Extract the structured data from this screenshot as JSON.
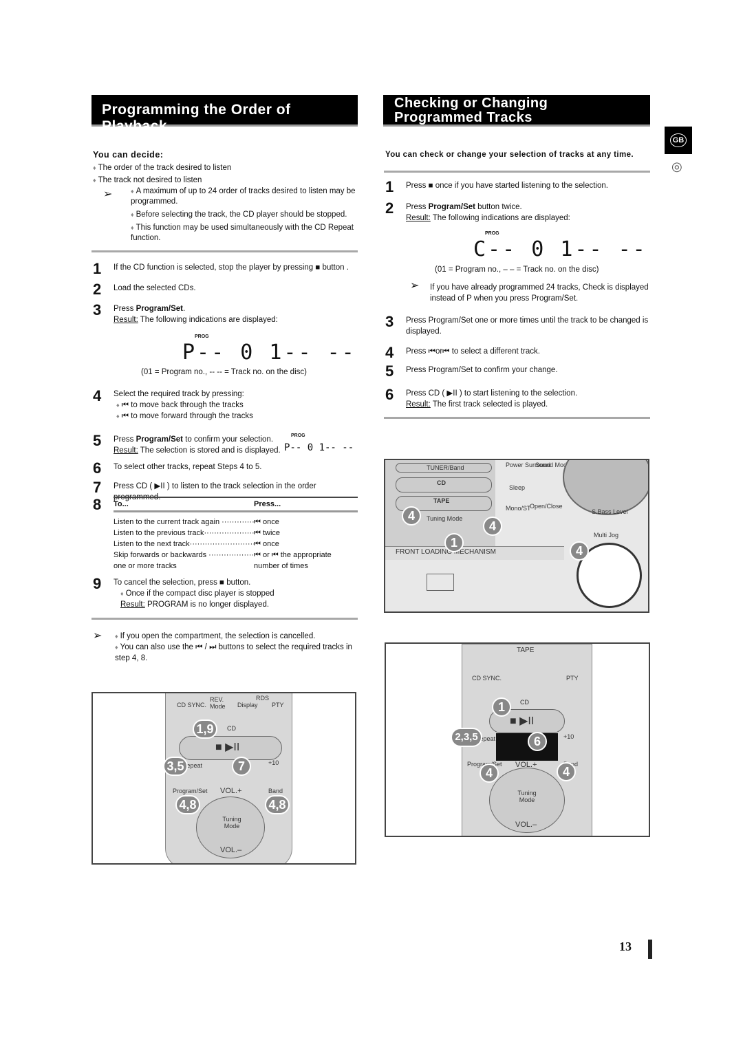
{
  "left": {
    "title": "Programming the Order of Playback",
    "decide_heading": "You can decide:",
    "decide_items": [
      "The order of the track desired to listen",
      "The track not desired to listen"
    ],
    "notes": [
      "A maximum of up to 24 order of tracks desired to listen may be programmed.",
      "Before selecting the track, the CD player should be stopped.",
      "This function may be used simultaneously with the CD Repeat function."
    ],
    "steps": {
      "s1": "If the CD function is selected, stop the player by pressing ■ button .",
      "s2": "Load the selected CDs.",
      "s3a": "Press ",
      "s3b": "Program/Set",
      "s3c": ".",
      "result": "Result:",
      "s3r": " The following indications are displayed:",
      "prog": "PROG",
      "lcd": "P-- 0 1-- --",
      "legend": "(01 = Program no., -- -- = Track no. on the disc)",
      "s4": "Select the required track by pressing:",
      "s4a": "⏮ to move back through the tracks",
      "s4b": "⏮ to move forward through the tracks",
      "s5a": "Press ",
      "s5b": "Program/Set",
      "s5c": " to confirm your selection.",
      "s5r": " The selection is stored and is displayed.",
      "s6": "To select other tracks, repeat Steps 4 to 5.",
      "s7": "Press CD ( ▶II ) to listen to the track selection in the order programmed.",
      "s9": "To cancel the selection, press ■ button.",
      "s9a": "Once if the compact disc player is stopped",
      "s9r": " PROGRAM is no longer displayed."
    },
    "table": {
      "h1": "To...",
      "h2": "Press...",
      "rows": [
        [
          "Listen to the current track again ················",
          "⏮ once"
        ],
        [
          "Listen to the previous track·······················",
          "⏮ twice"
        ],
        [
          "Listen to the next track······························",
          "⏮ once"
        ],
        [
          "Skip forwards or backwards ····················",
          "⏮ or ⏮ the appropriate"
        ],
        [
          "one or more tracks",
          "number of times"
        ]
      ]
    },
    "tips": [
      "If you open the compartment, the selection is cancelled.",
      "You can also use the ⏮ / ⏭ buttons to select the required tracks in step 4, 8."
    ]
  },
  "right": {
    "title": "Checking or Changing Programmed Tracks",
    "intro": "You can check or change your selection of tracks at any time.",
    "s1": "Press ■ once if you have started listening to the selection.",
    "s2a": "Press ",
    "s2b": "Program/Set",
    "s2c": " button twice.",
    "result": "Result:",
    "s2r": " The following indications are displayed:",
    "prog": "PROG",
    "lcd": "C-- 0 1-- --",
    "legend": "(01 = Program no., – – = Track no. on the disc)",
    "note": "If you have already programmed 24 tracks, Check is displayed instead of P when you press Program/Set.",
    "s3": "Press Program/Set one or more times until the track to be changed is displayed.",
    "s4": "Press ⏮or⏮ to select a different track.",
    "s5": "Press Program/Set to confirm your change.",
    "s6": "Press CD ( ▶II ) to start listening to the selection.",
    "s6r": " The first track selected is played."
  },
  "side": {
    "lang": "GB",
    "disc": "◎"
  },
  "page_number": "13",
  "ill_unit": {
    "tuner": "TUNER/Band",
    "cd": "CD",
    "tape": "TAPE",
    "tuning": "Tuning Mode",
    "power": "Power Surround",
    "sound": "Sound Mode",
    "sleep": "Sleep",
    "mono": "Mono/ST",
    "open": "Open/Close",
    "sbass": "S.Bass Level",
    "multijog": "Multi Jog",
    "front": "FRONT LOADING MECHANISM",
    "c1": "4",
    "c2": "4",
    "c3": "1",
    "c4": "4"
  },
  "ill_remote1": {
    "cdsync": "CD SYNC.",
    "rev": "REV. Mode",
    "display": "Display",
    "rds": "RDS",
    "pty": "PTY",
    "cd": "CD",
    "repeat": "Repeat",
    "plus10": "+10",
    "program": "Program/Set",
    "volp": "VOL.+",
    "band": "Band",
    "tuning": "Tuning Mode",
    "volm": "VOL.–",
    "c1": "1,9",
    "c2": "3,5",
    "c3": "7",
    "c4": "4,8",
    "c5": "4,8"
  },
  "ill_remote2": {
    "tape": "TAPE",
    "cdsync": "CD SYNC.",
    "pty": "PTY",
    "cd": "CD",
    "repeat": "Repeat",
    "plus10": "+10",
    "program": "Program/Set",
    "volp": "VOL.+",
    "band": "Band",
    "tuning": "Tuning Mode",
    "volm": "VOL.–",
    "c1": "1",
    "c2": "2,3,5",
    "c3": "6",
    "c4": "4",
    "c5": "4"
  }
}
